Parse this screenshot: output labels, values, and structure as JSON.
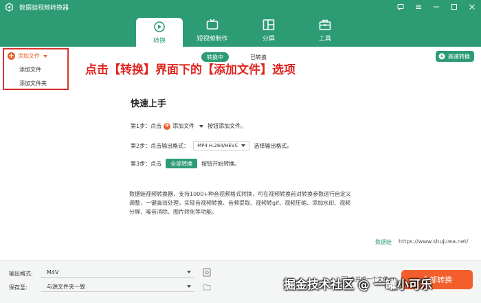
{
  "window": {
    "title": "数据蛙视频转换器"
  },
  "tabs": [
    {
      "label": "转换",
      "icon": "convert-icon"
    },
    {
      "label": "短视频制作",
      "icon": "tv-icon"
    },
    {
      "label": "分屏",
      "icon": "split-screen-icon"
    },
    {
      "label": "工具",
      "icon": "toolbox-icon"
    }
  ],
  "subtabs": [
    {
      "label": "转换中"
    },
    {
      "label": "已转换"
    }
  ],
  "speed_button": {
    "label": "高速转换"
  },
  "add_file_menu": {
    "label": "添加文件",
    "items": [
      "添加文件",
      "添加文件夹"
    ]
  },
  "annotation": "点击【转换】界面下的【添加文件】选项",
  "quick_start": {
    "title": "快速上手",
    "step1_prefix": "第1步：点击",
    "step1_button": "添加文件",
    "step1_suffix": "按钮添加文件。",
    "step2_prefix": "第2步：点击输出格式：",
    "step2_format": "MP4 H.264/HEVC",
    "step2_suffix": "选择输出格式。",
    "step3_prefix": "第3步：点击",
    "step3_button": "全部转换",
    "step3_suffix": "按钮开始转换。",
    "description": "数据蛙视频转换器，支持1000+种音视频格式转换，可在视频转换前对转换参数进行自定义调整，一键高效处理，实现音视频转换、音频提取、视频转gif、视频压缩、添加水印、视频分屏、噪音消除、图片转化等功能。",
    "brand": "数据蛙",
    "site": "https://www.shujuwa.net/"
  },
  "bottom": {
    "output_format_label": "输出格式:",
    "output_format_value": "M4V",
    "save_to_label": "保存至:",
    "save_to_value": "与源文件夹一致",
    "merge_label": "合并成一个文件",
    "convert_all_label": "全部转换"
  },
  "watermark": "掘金技术社区 @ 一罐小可乐",
  "colors": {
    "brand_green": "#2d9b74",
    "accent_orange": "#f25f2c",
    "annotation_red": "#e0241f"
  }
}
